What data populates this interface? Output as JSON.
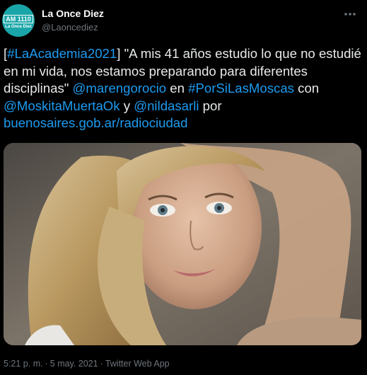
{
  "author": {
    "display_name": "La Once Diez",
    "handle": "@Laoncediez",
    "avatar_logo_top": "AM 1110",
    "avatar_logo_bottom": "La Once Diez",
    "avatar_color": "#1aa6a8"
  },
  "menu": {
    "more_icon": "more-horizontal-icon"
  },
  "tweet": {
    "segments": [
      {
        "text": "[",
        "link": false
      },
      {
        "text": "#LaAcademia2021",
        "link": true
      },
      {
        "text": "] \"A mis 41 años estudio lo que no estudié en mi vida, nos estamos preparando para diferentes disciplinas\" ",
        "link": false
      },
      {
        "text": "@marengorocio",
        "link": true
      },
      {
        "text": " en ",
        "link": false
      },
      {
        "text": "#PorSiLasMoscas",
        "link": true
      },
      {
        "text": " con ",
        "link": false
      },
      {
        "text": "@MoskitaMuertaOk",
        "link": true
      },
      {
        "text": " y ",
        "link": false
      },
      {
        "text": "@nildasarli",
        "link": true
      },
      {
        "text": " por ",
        "link": false
      },
      {
        "text": "buenosaires.gob.ar/radiociudad",
        "link": true
      }
    ]
  },
  "footer": {
    "time": "5:21 p. m.",
    "separator": "·",
    "date": "5 may. 2021",
    "source": "Twitter Web App"
  },
  "colors": {
    "background": "#000000",
    "text": "#e7e9ea",
    "link": "#1d9bf0",
    "muted": "#6e767d"
  }
}
